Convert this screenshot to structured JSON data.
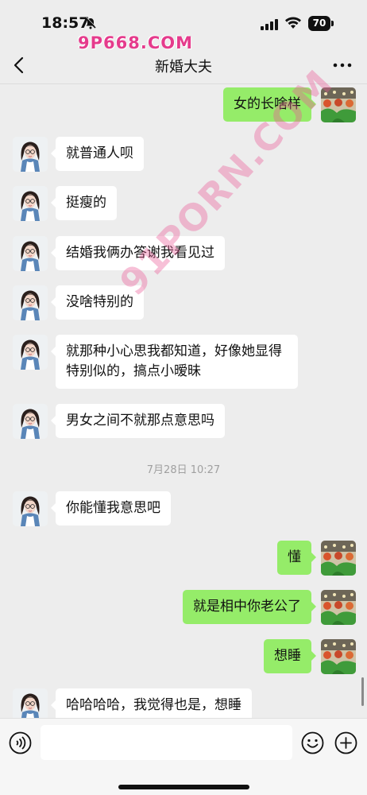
{
  "status_bar": {
    "time": "18:57",
    "battery": "70"
  },
  "watermarks": {
    "top": "9P668.COM",
    "diagonal": "91PORN.COM"
  },
  "nav": {
    "title": "新婚大夫"
  },
  "messages": [
    {
      "side": "out",
      "text": "女的长啥样"
    },
    {
      "side": "in",
      "text": "就普通人呗"
    },
    {
      "side": "in",
      "text": "挺瘦的"
    },
    {
      "side": "in",
      "text": "结婚我俩办答谢我看见过"
    },
    {
      "side": "in",
      "text": "没啥特别的"
    },
    {
      "side": "in",
      "text": "就那种小心思我都知道，好像她显得特别似的，搞点小暧昧"
    },
    {
      "side": "in",
      "text": "男女之间不就那点意思吗"
    },
    {
      "side": "in",
      "text": "你能懂我意思吧"
    },
    {
      "side": "out",
      "text": "懂"
    },
    {
      "side": "out",
      "text": "就是相中你老公了"
    },
    {
      "side": "out",
      "text": "想睡"
    },
    {
      "side": "in",
      "text": "哈哈哈哈，我觉得也是，想睡"
    }
  ],
  "timestamp": "7月28日 10:27",
  "colors": {
    "background": "#ededed",
    "incoming_bubble": "#ffffff",
    "outgoing_bubble": "#95ec69",
    "watermark": "#e53b8c"
  }
}
